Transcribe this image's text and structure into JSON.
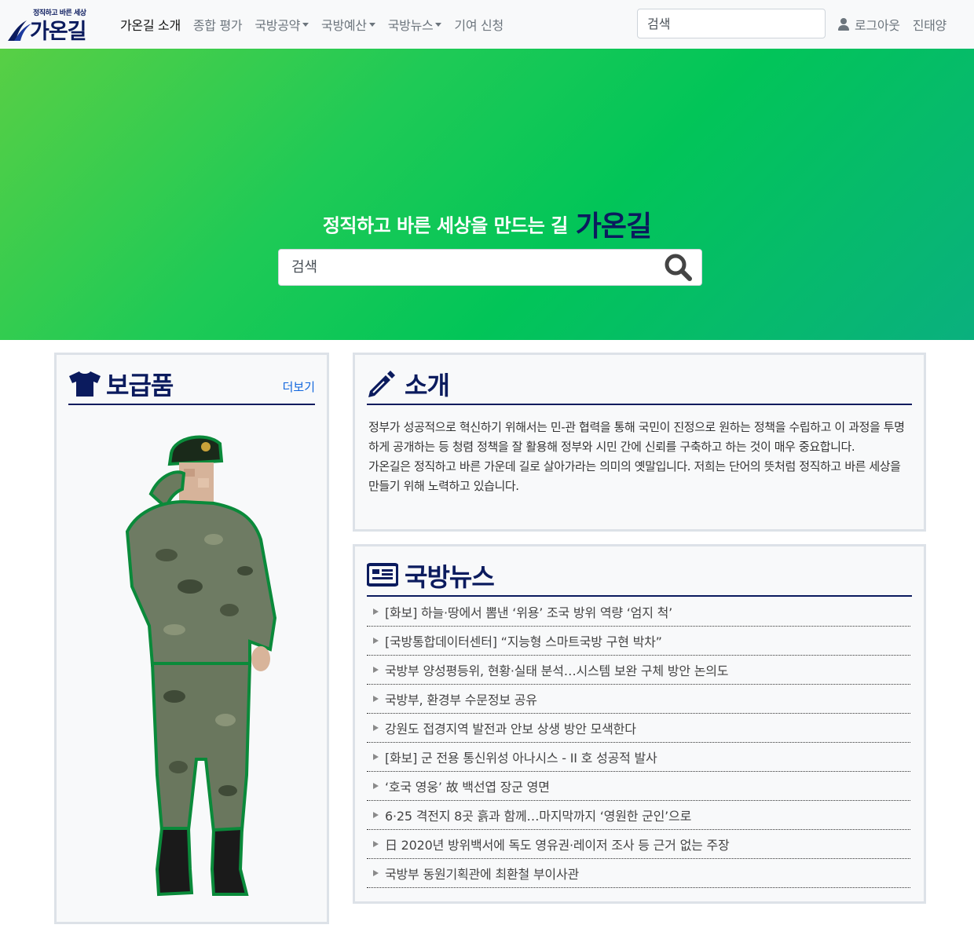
{
  "navbar": {
    "logo_tagline": "정직하고 바른 세상",
    "logo_name": "가온길",
    "items": [
      {
        "label": "가온길 소개",
        "active": true,
        "dropdown": false
      },
      {
        "label": "종합 평가",
        "active": false,
        "dropdown": false
      },
      {
        "label": "국방공약",
        "active": false,
        "dropdown": true
      },
      {
        "label": "국방예산",
        "active": false,
        "dropdown": true
      },
      {
        "label": "국방뉴스",
        "active": false,
        "dropdown": true
      },
      {
        "label": "기여 신청",
        "active": false,
        "dropdown": false
      }
    ],
    "search_placeholder": "검색",
    "logout_label": "로그아웃",
    "user_name": "진태양"
  },
  "hero": {
    "slogan": "정직하고 바른 세상을 만드는 길",
    "brand": "가온길",
    "search_placeholder": "검색"
  },
  "supply": {
    "title": "보급품",
    "more_label": "더보기",
    "icon": "tshirt-icon",
    "image": "soldier-saluting-image"
  },
  "intro": {
    "title": "소개",
    "icon": "pencil-icon",
    "paragraph1": "정부가 성공적으로 혁신하기 위해서는 민-관 협력을 통해 국민이 진정으로 원하는 정책을 수립하고 이 과정을 투명하게 공개하는 등 청렴 정책을 잘 활용해 정부와 시민 간에 신뢰를 구축하고 하는 것이 매우 중요합니다.",
    "paragraph2": "가온길은 정직하고 바른 가운데 길로 살아가라는 의미의 옛말입니다. 저희는 단어의 뜻처럼 정직하고 바른 세상을 만들기 위해 노력하고 있습니다."
  },
  "news": {
    "title": "국방뉴스",
    "icon": "newspaper-icon",
    "items": [
      "[화보] 하늘·땅에서 뽐낸 ‘위용’ 조국 방위 역량 ‘엄지 척’",
      "[국방통합데이터센터] “지능형 스마트국방 구현 박차”",
      "국방부 양성평등위, 현황·실태 분석…시스템 보완 구체 방안 논의도",
      "국방부, 환경부 수문정보 공유",
      "강원도 접경지역 발전과 안보 상생 방안 모색한다",
      "[화보] 군 전용 통신위성 아나시스 - II 호 성공적 발사",
      "‘호국 영웅’ 故 백선엽 장군 영면",
      "6·25 격전지 8곳 흙과 함께…마지막까지 ‘영원한 군인’으로",
      "日 2020년 방위백서에 독도 영유권·레이저 조사 등 근거 없는 주장",
      "국방부 동원기획관에 최환철 부이사관"
    ]
  },
  "colors": {
    "brand_navy": "#0b1b5e",
    "hero_green": "#02c558",
    "link_blue": "#1166dd"
  }
}
